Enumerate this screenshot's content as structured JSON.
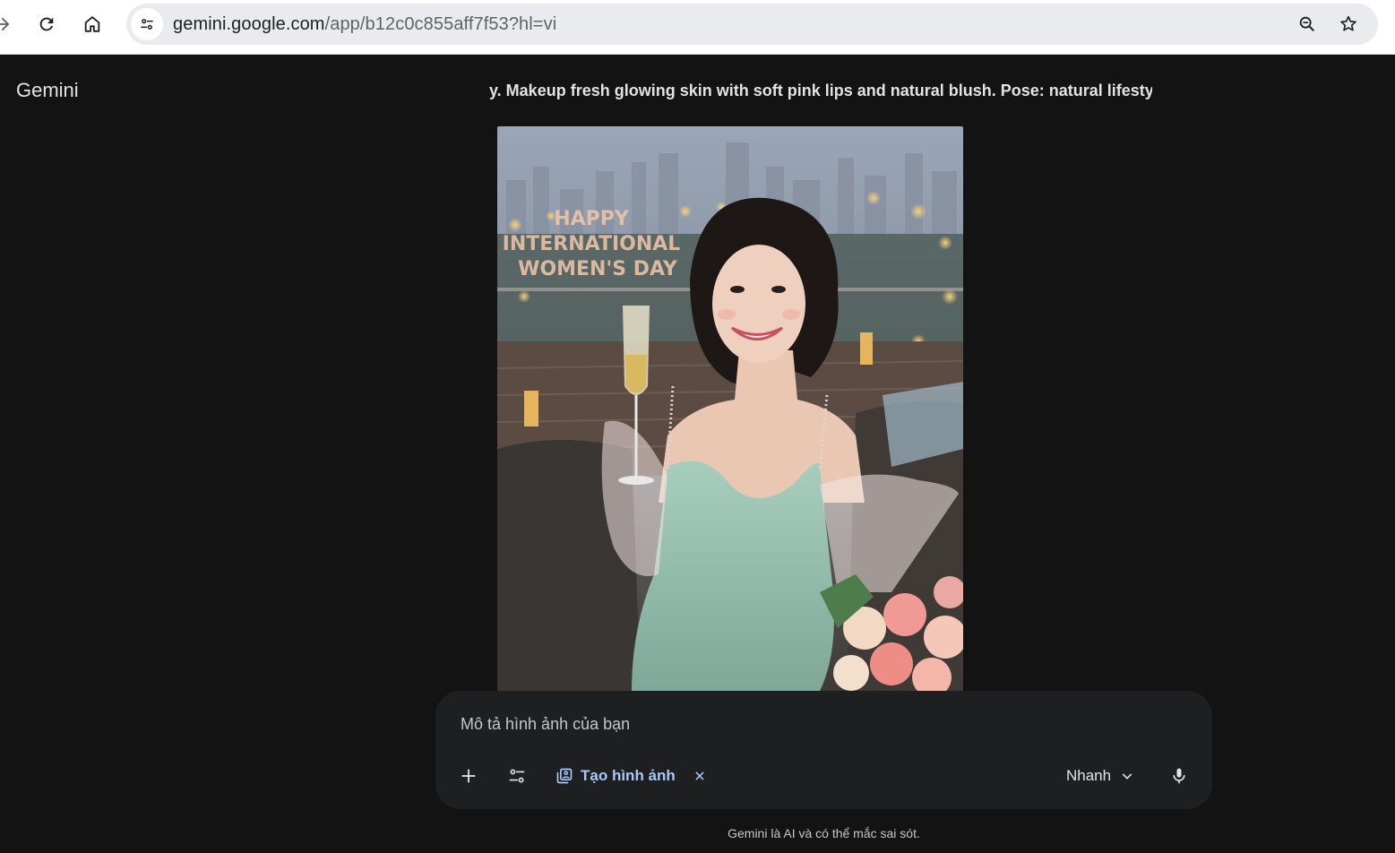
{
  "browser": {
    "url_domain": "gemini.google.com",
    "url_path": "/app/b12c0c855aff7f53?hl=vi",
    "icons": [
      "forward-arrow-icon",
      "reload-icon",
      "home-icon",
      "site-info-icon",
      "zoom-icon",
      "bookmark-star-icon"
    ]
  },
  "app": {
    "brand": "Gemini",
    "prompt_excerpt": "y. Makeup fresh glowing skin with soft pink lips and natural blush. Pose: natural lifesty"
  },
  "generated_image": {
    "sign_lines": [
      "HAPPY",
      "INTERNATIONAL",
      "WOMEN'S DAY"
    ]
  },
  "composer": {
    "placeholder": "Mô tả hình ảnh của bạn",
    "chip_label": "Tạo hình ảnh",
    "mode_label": "Nhanh",
    "icons": [
      "plus-icon",
      "tools-icon",
      "image-gen-icon",
      "close-icon",
      "chevron-down-icon",
      "mic-icon"
    ]
  },
  "footer": {
    "disclaimer": "Gemini là AI và có thể mắc sai sót."
  },
  "colors": {
    "app_bg": "#131314",
    "composer_bg": "#1e1f20",
    "chip_accent": "#a8c7fa",
    "text": "#e3e3e3"
  }
}
